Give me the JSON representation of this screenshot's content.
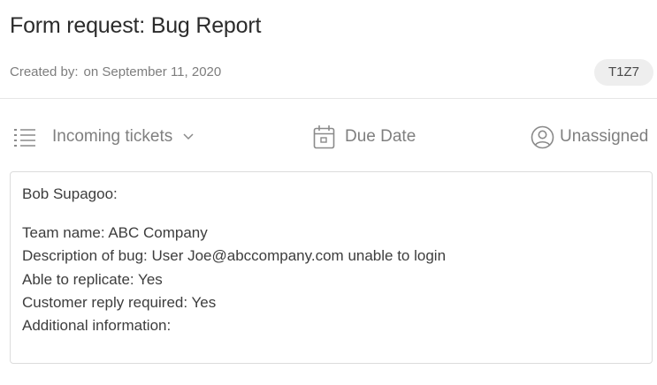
{
  "header": {
    "title": "Form request: Bug Report",
    "created_by_label": "Created by:",
    "created_date": "on September 11, 2020",
    "ticket_id": "T1Z7"
  },
  "toolbar": {
    "list_icon": "list-icon",
    "status": "Incoming tickets",
    "status_chevron_icon": "chevron-down-icon",
    "due_icon": "calendar-icon",
    "due_label": "Due Date",
    "assignee_icon": "user-circle-icon",
    "assignee_label": "Unassigned"
  },
  "message": {
    "greeting": "Bob Supagoo:",
    "lines": [
      "Team name: ABC Company",
      "Description of bug: User Joe@abccompany.com unable to login",
      "Able to replicate: Yes",
      "Customer reply required: Yes",
      "Additional information:"
    ]
  },
  "colors": {
    "text": "#333333",
    "muted": "#7f7f7f",
    "badge_bg": "#eeeeee",
    "border": "#dcdcdc"
  }
}
